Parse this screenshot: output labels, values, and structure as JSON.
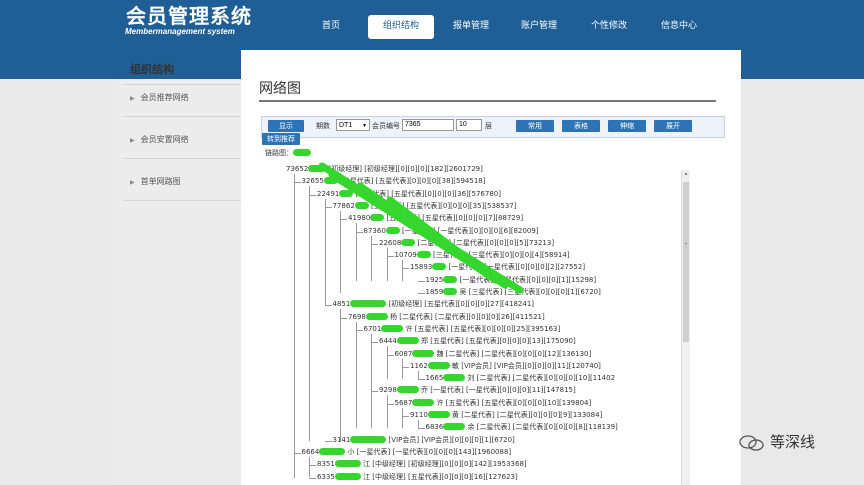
{
  "logo": {
    "cn": "会员管理系统",
    "en": "Membermanagement system"
  },
  "nav": [
    "首页",
    "组织结构",
    "报单管理",
    "账户管理",
    "个性修改",
    "信息中心"
  ],
  "nav_active": "组织结构",
  "sidebar": {
    "title": "组织结构",
    "items": [
      "会员推荐网络",
      "会员安置网络",
      "首单网路图"
    ]
  },
  "page_title": "网络图",
  "toolbar": {
    "display_btn": "显示",
    "transfer_btn": "转到推荐",
    "period_label": "期数",
    "period_value": "DT1",
    "member_label": "会员编号",
    "member_value": "7365",
    "levels_value": "10",
    "levels_label": "层",
    "btn_normal": "常用",
    "btn_table": "表格",
    "btn_expand": "伸缩",
    "btn_open": "展开"
  },
  "chain_label": "链路图：",
  "tree": [
    {
      "id": "73652",
      "info": "[初级经理]  [初级经理][0][0][0][182][2601729]"
    },
    {
      "id": "32655",
      "info": "[五星代表]  [五星代表][0][0][0][38][594518]"
    },
    {
      "id": "22491",
      "info": "[五星代表]  [五星代表][0][0][0][36][576780]"
    },
    {
      "id": "77862",
      "info": "[五星代表]  [五星代表][0][0][0][35][538537]"
    },
    {
      "id": "41980",
      "info": "[五星代表]  [五星代表][0][0][0][7][88729]"
    },
    {
      "id": "87360",
      "info": "[一星代表]  [一星代表][0][0][0][6][82009]"
    },
    {
      "id": "22608",
      "info": "[二星代表]  [二星代表][0][0][0][5][73213]"
    },
    {
      "id": "10709",
      "info": "[三星代表]  [三星代表][0][0][0][4][58914]"
    },
    {
      "id": "15893",
      "info": "[一星代表]  [一星代表][0][0][0][2][27552]"
    },
    {
      "id": "1925",
      "info": "[一星代表]  [一星代表][0][0][0][1][15298]"
    },
    {
      "id": "1859",
      "info": "吴  [三星代表]  [三星代表][0][0][0][1][6720]"
    },
    {
      "id": "4851",
      "info": "[初级经理]  [五星代表][0][0][0][27][418241]"
    },
    {
      "id": "7698",
      "info": "杨  [二星代表]  [二星代表][0][0][0][26][411521]"
    },
    {
      "id": "6701",
      "info": "许  [五星代表]  [五星代表][0][0][0][25][395163]"
    },
    {
      "id": "6444",
      "info": "郑  [五星代表]  [五星代表][0][0][0][13][175090]"
    },
    {
      "id": "6087",
      "info": "魏  [二星代表]  [二星代表][0][0][0][12][136130]"
    },
    {
      "id": "1162",
      "info": "敏  [VIP会员]  [VIP会员][0][0][0][11][120740]"
    },
    {
      "id": "1665",
      "info": "刘  [二星代表]  [二星代表][0][0][0][10][11402"
    },
    {
      "id": "9298",
      "info": "乔  [一星代表]  [一星代表][0][0][0][11][147815]"
    },
    {
      "id": "5687",
      "info": "许  [五星代表]  [五星代表][0][0][0][10][139804]"
    },
    {
      "id": "9110",
      "info": "黄  [二星代表]  [二星代表][0][0][0][9][133084]"
    },
    {
      "id": "6836",
      "info": "余  [二星代表]  [二星代表][0][0][0][8][118139]"
    },
    {
      "id": "3141",
      "info": "[VIP会员]  [VIP会员][0][0][0][1][6720]"
    },
    {
      "id": "6664",
      "info": "小  [一星代表]  [一星代表][0][0][0][143][1960088]"
    },
    {
      "id": "8351",
      "info": "江  [中级经理]  [初级经理][0][0][0][142][1953368]"
    },
    {
      "id": "6335",
      "info": "江  [中级经理]  [五星代表][0][0][0][16][127623]"
    }
  ],
  "watermark": "等深线",
  "colors": {
    "header": "#1f5f96",
    "button": "#2d74b6",
    "mask": "#35d62e"
  }
}
